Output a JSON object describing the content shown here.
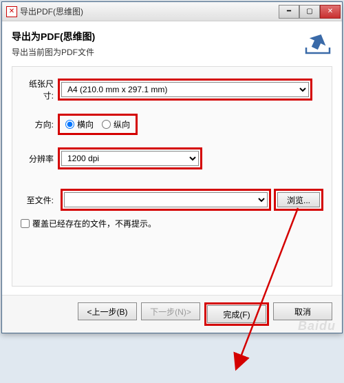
{
  "titlebar": {
    "title": "导出PDF(思维图)"
  },
  "header": {
    "title": "导出为PDF(思维图)",
    "subtitle": "导出当前图为PDF文件"
  },
  "form": {
    "paper_label": "纸张尺寸:",
    "paper_value": "A4 (210.0 mm x 297.1 mm)",
    "orientation_label": "方向:",
    "orientation_landscape": "横向",
    "orientation_portrait": "纵向",
    "dpi_label": "分辨率",
    "dpi_value": "1200 dpi",
    "file_label": "至文件:",
    "file_value": "",
    "browse_label": "浏览...",
    "overwrite_label": "覆盖已经存在的文件，不再提示。"
  },
  "footer": {
    "prev": "<上一步(B)",
    "next": "下一步(N)>",
    "finish": "完成(F)",
    "cancel": "取消"
  },
  "watermark": "Baidu"
}
